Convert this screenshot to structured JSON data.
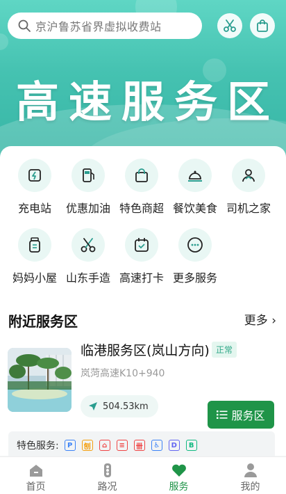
{
  "search": {
    "placeholder": "京沪鲁苏省界虚拟收费站"
  },
  "hero": {
    "title": "高速服务区"
  },
  "services": [
    {
      "label": "充电站",
      "icon": "charging-icon"
    },
    {
      "label": "优惠加油",
      "icon": "fuel-icon"
    },
    {
      "label": "特色商超",
      "icon": "shopping-bag-icon"
    },
    {
      "label": "餐饮美食",
      "icon": "dining-bell-icon"
    },
    {
      "label": "司机之家",
      "icon": "driver-icon"
    },
    {
      "label": "妈妈小屋",
      "icon": "baby-bottle-icon"
    },
    {
      "label": "山东手造",
      "icon": "scissors-icon"
    },
    {
      "label": "高速打卡",
      "icon": "calendar-check-icon"
    },
    {
      "label": "更多服务",
      "icon": "more-icon"
    }
  ],
  "nearby": {
    "title": "附近服务区",
    "more": "更多 ›",
    "item": {
      "name": "临港服务区(岚山方向)",
      "status": "正常",
      "road": "岚菏高速K10+940",
      "distance": "504.53km",
      "button": "服务区"
    },
    "features_label": "特色服务:",
    "features": [
      {
        "glyph": "P",
        "color": "#3b82f6"
      },
      {
        "glyph": "刨",
        "color": "#f59e0b"
      },
      {
        "glyph": "⌂",
        "color": "#ef4444"
      },
      {
        "glyph": "≡",
        "color": "#ef4444"
      },
      {
        "glyph": "卌",
        "color": "#ef4444"
      },
      {
        "glyph": "♿",
        "color": "#3b82f6"
      },
      {
        "glyph": "D",
        "color": "#6366f1"
      },
      {
        "glyph": "B",
        "color": "#10b981"
      }
    ]
  },
  "tabbar": [
    {
      "label": "首页",
      "icon": "home-icon",
      "active": false
    },
    {
      "label": "路况",
      "icon": "traffic-light-icon",
      "active": false
    },
    {
      "label": "服务",
      "icon": "heart-icon",
      "active": true
    },
    {
      "label": "我的",
      "icon": "user-icon",
      "active": false
    }
  ],
  "colors": {
    "accent": "#1f9448",
    "hero": "#45c2b1",
    "icon_bg": "#e9f7f4"
  }
}
